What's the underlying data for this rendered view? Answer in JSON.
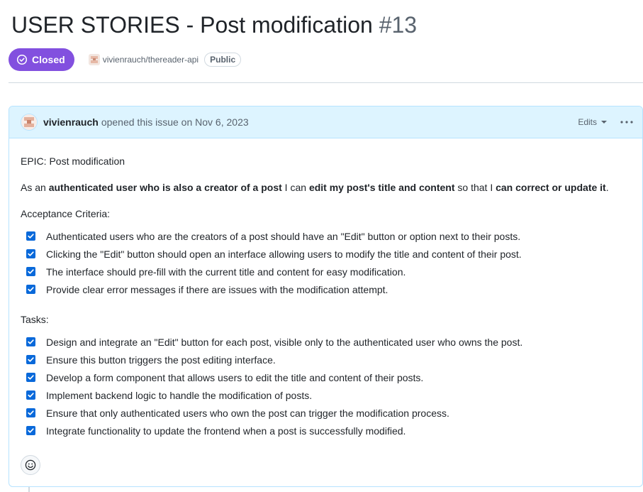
{
  "issue": {
    "title": "USER STORIES - Post modification",
    "number": "#13",
    "state": "Closed",
    "state_color": "#8250df",
    "repo": "vivienrauch/thereader-api",
    "visibility": "Public"
  },
  "comment": {
    "author": "vivienrauch",
    "opened_text": "opened this issue on Nov 6, 2023",
    "edits_label": "Edits",
    "more_icon": "kebab-horizontal-icon",
    "reaction_icon": "smiley-icon",
    "epic": "EPIC: Post modification",
    "story": {
      "t1": "As an ",
      "b1": "authenticated user who is also a creator of a post",
      "t2": " I can ",
      "b2": "edit my post's title and content",
      "t3": " so that I ",
      "b3": "can correct or update it",
      "t4": "."
    },
    "acceptance_heading": "Acceptance Criteria:",
    "acceptance": [
      {
        "text": "Authenticated users who are the creators of a post should have an \"Edit\" button or option next to their posts.",
        "checked": true
      },
      {
        "text": "Clicking the \"Edit\" button should open an interface allowing users to modify the title and content of their post.",
        "checked": true
      },
      {
        "text": "The interface should pre-fill with the current title and content for easy modification.",
        "checked": true
      },
      {
        "text": "Provide clear error messages if there are issues with the modification attempt.",
        "checked": true
      }
    ],
    "tasks_heading": "Tasks:",
    "tasks": [
      {
        "text": "Design and integrate an \"Edit\" button for each post, visible only to the authenticated user who owns the post.",
        "checked": true
      },
      {
        "text": "Ensure this button triggers the post editing interface.",
        "checked": true
      },
      {
        "text": "Develop a form component that allows users to edit the title and content of their posts.",
        "checked": true
      },
      {
        "text": "Implement backend logic to handle the modification of posts.",
        "checked": true
      },
      {
        "text": "Ensure that only authenticated users who own the post can trigger the modification process.",
        "checked": true
      },
      {
        "text": "Integrate functionality to update the frontend when a post is successfully modified.",
        "checked": true
      }
    ]
  }
}
